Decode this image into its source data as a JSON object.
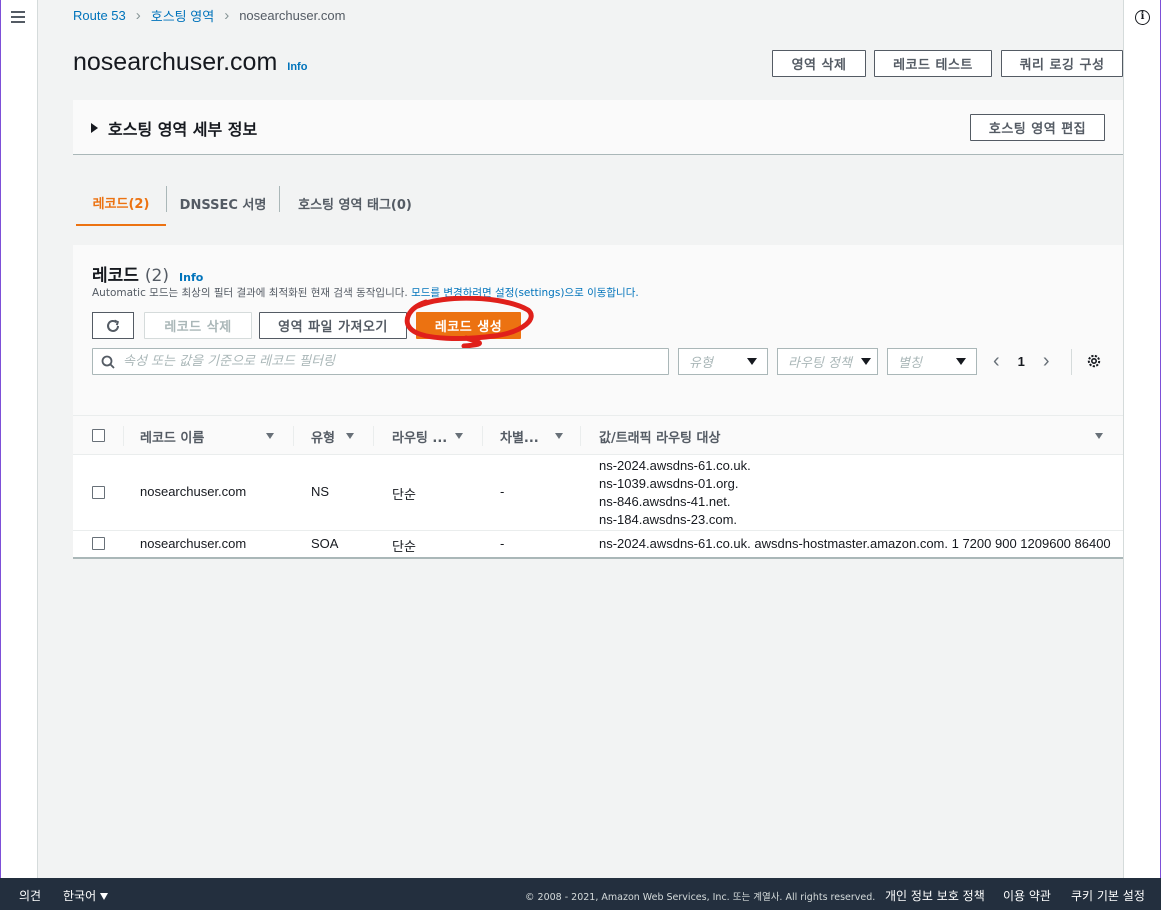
{
  "breadcrumb": {
    "items": [
      "Route 53",
      "호스팅 영역",
      "nosearchuser.com"
    ]
  },
  "header": {
    "title": "nosearchuser.com",
    "info": "Info",
    "buttons": {
      "delete_zone": "영역 삭제",
      "test_record": "레코드 테스트",
      "query_logging": "쿼리 로깅 구성"
    }
  },
  "details": {
    "title": "호스팅 영역 세부 정보",
    "edit_button": "호스팅 영역 편집"
  },
  "tabs": [
    {
      "label": "레코드(2)",
      "active": true
    },
    {
      "label": "DNSSEC 서명",
      "active": false
    },
    {
      "label": "호스팅 영역 태그(0)",
      "active": false
    }
  ],
  "records": {
    "title": "레코드",
    "count": "(2)",
    "info": "Info",
    "desc_prefix": "Automatic 모드는 최상의 필터 결과에 최적화된 현재 검색 동작입니다. ",
    "desc_link": "모드를 변경하려면 설정(settings)으로 이동합니다.",
    "buttons": {
      "delete": "레코드 삭제",
      "import": "영역 파일 가져오기",
      "create": "레코드 생성"
    },
    "search_placeholder": "속성 또는 값을 기준으로 레코드 필터링",
    "filters": {
      "type": "유형",
      "routing_policy": "라우팅 정책",
      "alias": "별칭"
    },
    "page": "1",
    "columns": [
      "레코드 이름",
      "유형",
      "라우팅 ...",
      "차별...",
      "값/트래픽 라우팅 대상"
    ],
    "rows": [
      {
        "name": "nosearchuser.com",
        "type": "NS",
        "routing": "단순",
        "diff": "-",
        "values": [
          "ns-2024.awsdns-61.co.uk.",
          "ns-1039.awsdns-01.org.",
          "ns-846.awsdns-41.net.",
          "ns-184.awsdns-23.com."
        ]
      },
      {
        "name": "nosearchuser.com",
        "type": "SOA",
        "routing": "단순",
        "diff": "-",
        "values": [
          "ns-2024.awsdns-61.co.uk. awsdns-hostmaster.amazon.com. 1 7200 900 1209600 86400"
        ]
      }
    ]
  },
  "footer": {
    "feedback": "의견",
    "language": "한국어",
    "copyright": "© 2008 - 2021, Amazon Web Services, Inc. 또는 계열사. All rights reserved.",
    "privacy": "개인 정보 보호 정책",
    "terms": "이용 약관",
    "cookies": "쿠키 기본 설정"
  },
  "colors": {
    "accent": "#ec7211",
    "link": "#0073bb",
    "footer_bg": "#232f3e",
    "annotation": "#e0201b"
  }
}
